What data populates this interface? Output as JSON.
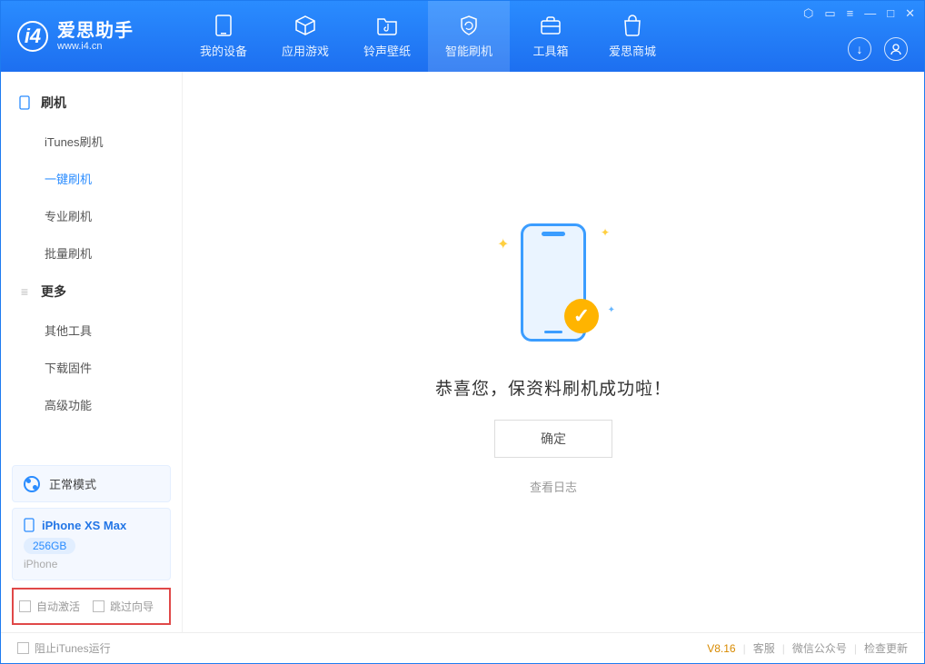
{
  "app": {
    "title": "爱思助手",
    "url": "www.i4.cn"
  },
  "tabs": [
    {
      "label": "我的设备"
    },
    {
      "label": "应用游戏"
    },
    {
      "label": "铃声壁纸"
    },
    {
      "label": "智能刷机"
    },
    {
      "label": "工具箱"
    },
    {
      "label": "爱思商城"
    }
  ],
  "active_tab": 3,
  "sidebar": {
    "sections": [
      {
        "title": "刷机",
        "items": [
          "iTunes刷机",
          "一键刷机",
          "专业刷机",
          "批量刷机"
        ],
        "active": 1
      },
      {
        "title": "更多",
        "items": [
          "其他工具",
          "下载固件",
          "高级功能"
        ],
        "active": -1
      }
    ],
    "mode_label": "正常模式",
    "device": {
      "name": "iPhone XS Max",
      "storage": "256GB",
      "type": "iPhone"
    },
    "options": {
      "auto_activate": "自动激活",
      "skip_guide": "跳过向导"
    }
  },
  "main": {
    "success_message": "恭喜您，保资料刷机成功啦！",
    "ok_button": "确定",
    "view_log": "查看日志"
  },
  "footer": {
    "block_itunes": "阻止iTunes运行",
    "version": "V8.16",
    "links": [
      "客服",
      "微信公众号",
      "检查更新"
    ]
  }
}
